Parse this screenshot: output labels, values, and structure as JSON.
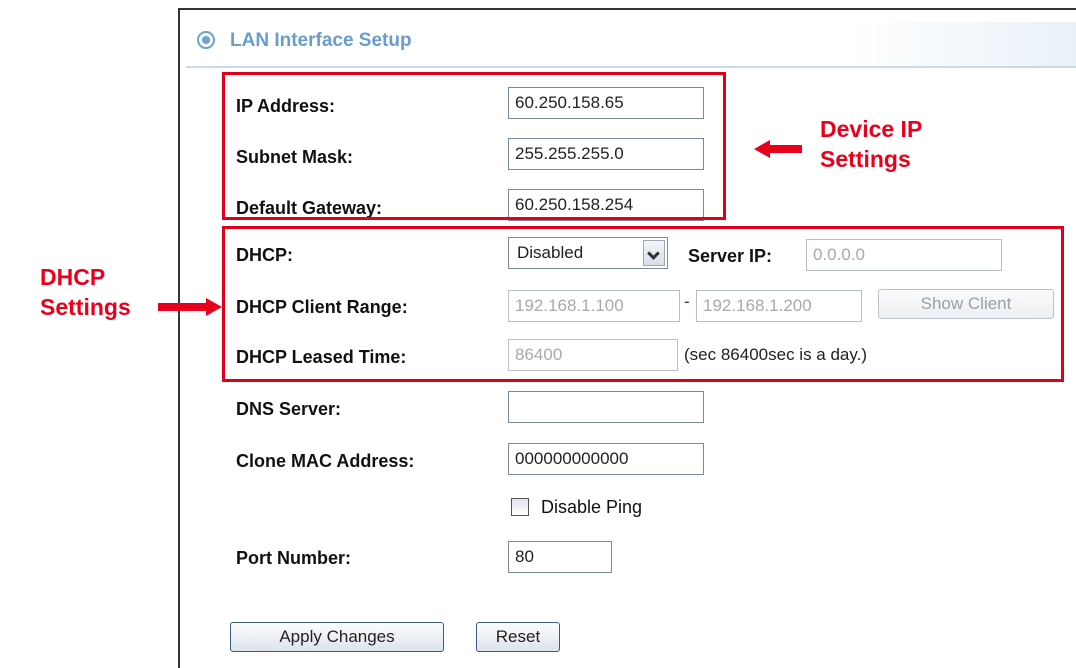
{
  "section": {
    "title": "LAN Interface Setup"
  },
  "fields": {
    "ip_address": {
      "label": "IP Address:",
      "value": "60.250.158.65"
    },
    "subnet_mask": {
      "label": "Subnet Mask:",
      "value": "255.255.255.0"
    },
    "default_gateway": {
      "label": "Default Gateway:",
      "value": "60.250.158.254"
    },
    "dhcp": {
      "label": "DHCP:",
      "selected": "Disabled"
    },
    "server_ip": {
      "label": "Server IP:",
      "value": "0.0.0.0"
    },
    "dhcp_client_range": {
      "label": "DHCP Client Range:",
      "start": "192.168.1.100",
      "separator": "-",
      "end": "192.168.1.200"
    },
    "show_client": {
      "label": "Show Client"
    },
    "dhcp_leased_time": {
      "label": "DHCP Leased Time:",
      "value": "86400",
      "note": "(sec 86400sec is a day.)"
    },
    "dns_server": {
      "label": "DNS Server:",
      "value": ""
    },
    "clone_mac": {
      "label": "Clone MAC Address:",
      "value": "000000000000"
    },
    "disable_ping": {
      "label": "Disable Ping",
      "checked": false
    },
    "port_number": {
      "label": "Port Number:",
      "value": "80"
    }
  },
  "buttons": {
    "apply": "Apply Changes",
    "reset": "Reset"
  },
  "annotations": {
    "device_ip": {
      "line1": "Device IP",
      "line2": "Settings"
    },
    "dhcp": {
      "line1": "DHCP",
      "line2": "Settings"
    }
  },
  "colors": {
    "highlight": "#e8001c",
    "header_text": "#6a9ccd"
  }
}
